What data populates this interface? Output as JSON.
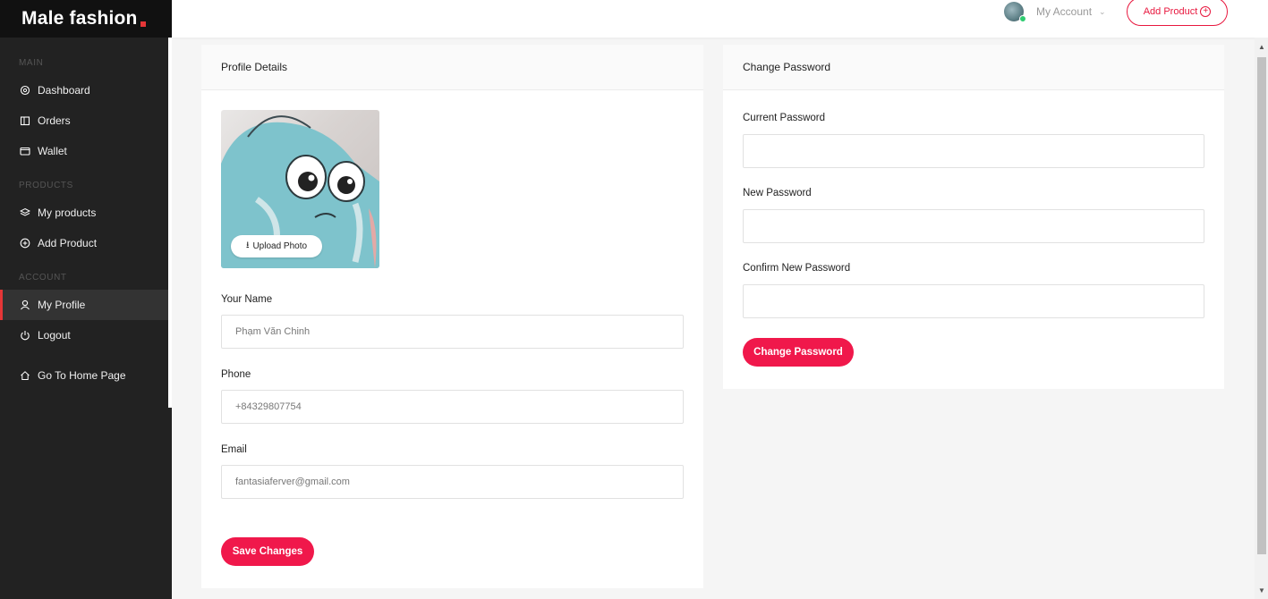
{
  "brand": {
    "name": "Male fashion"
  },
  "sidebar": {
    "sections": {
      "main": "MAIN",
      "products": "PRODUCTS",
      "account": "ACCOUNT"
    },
    "items": [
      {
        "label": "Dashboard",
        "icon": "dashboard-icon"
      },
      {
        "label": "Orders",
        "icon": "orders-icon"
      },
      {
        "label": "Wallet",
        "icon": "wallet-icon"
      },
      {
        "label": "My products",
        "icon": "layers-icon"
      },
      {
        "label": "Add Product",
        "icon": "plus-circle-icon"
      },
      {
        "label": "My Profile",
        "icon": "user-icon",
        "active": true
      },
      {
        "label": "Logout",
        "icon": "power-icon"
      },
      {
        "label": "Go To Home Page",
        "icon": "home-icon"
      }
    ]
  },
  "topbar": {
    "account_label": "My Account",
    "add_product_label": "Add Product"
  },
  "profile": {
    "title": "Profile Details",
    "upload_label": "Upload Photo",
    "name_label": "Your Name",
    "name_value": "Phạm Văn Chinh",
    "phone_label": "Phone",
    "phone_value": "+84329807754",
    "email_label": "Email",
    "email_value": "fantasiaferver@gmail.com",
    "save_label": "Save Changes"
  },
  "password": {
    "title": "Change Password",
    "current_label": "Current Password",
    "new_label": "New Password",
    "confirm_label": "Confirm New Password",
    "submit_label": "Change Password"
  },
  "colors": {
    "accent": "#e53637",
    "button": "#f0184b",
    "sidebar_bg": "#222222"
  }
}
